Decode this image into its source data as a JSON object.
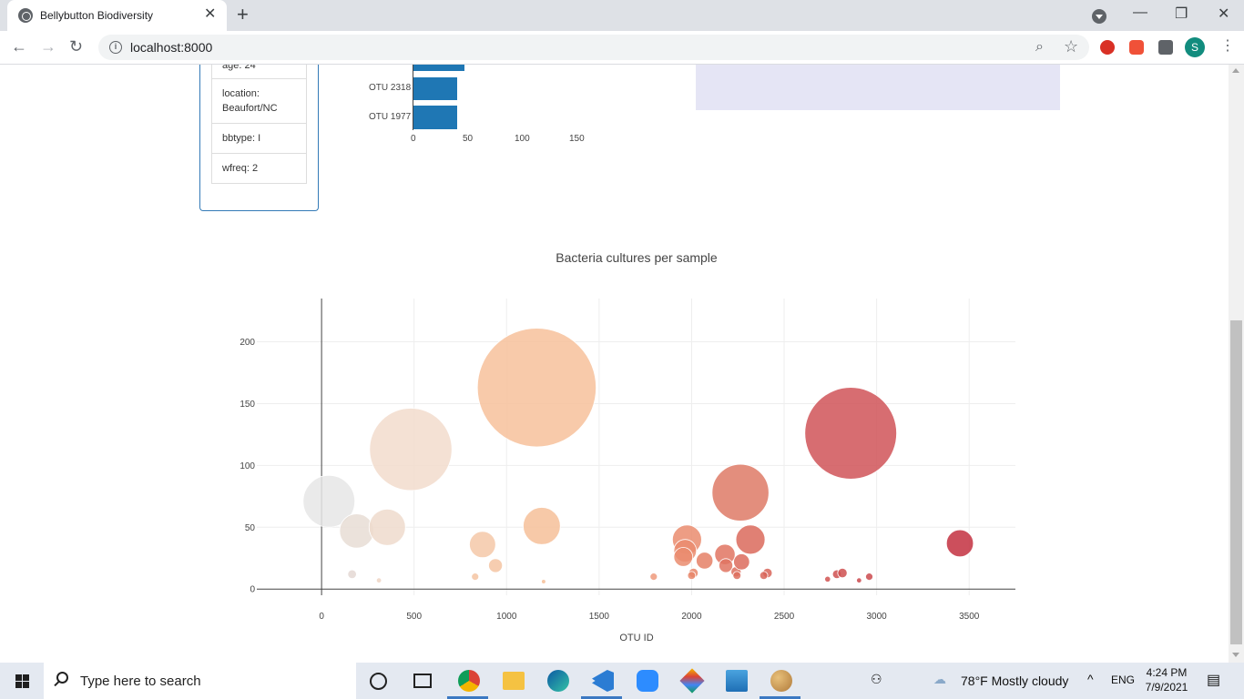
{
  "browser": {
    "tab_title": "Bellybutton Biodiversity",
    "url": "localhost:8000",
    "profile_initial": "S"
  },
  "metadata": {
    "age": "age: 24",
    "location": "location: Beaufort/NC",
    "bbtype": "bbtype: I",
    "wfreq": "wfreq: 2"
  },
  "bar_chart_fragment": {
    "labels": [
      "OTU 2318",
      "OTU 1977"
    ],
    "values": [
      40,
      40
    ],
    "partial_bar_value": 47,
    "x_ticks": [
      "0",
      "50",
      "100",
      "150"
    ]
  },
  "chart_data": {
    "type": "scatter",
    "title": "Bacteria cultures per sample",
    "xlabel": "OTU ID",
    "ylabel": "",
    "xlim": [
      -350,
      3750
    ],
    "ylim": [
      -5,
      235
    ],
    "x_ticks": [
      0,
      500,
      1000,
      1500,
      2000,
      2500,
      3000,
      3500
    ],
    "y_ticks": [
      0,
      50,
      100,
      150,
      200
    ],
    "grid": true,
    "points": [
      {
        "x": 40,
        "y": 71,
        "size": 71,
        "color": "#e6e6e6"
      },
      {
        "x": 190,
        "y": 47,
        "size": 47,
        "color": "#e8ddd5"
      },
      {
        "x": 355,
        "y": 50,
        "size": 50,
        "color": "#eedacc"
      },
      {
        "x": 482,
        "y": 113,
        "size": 113,
        "color": "#f2dccc"
      },
      {
        "x": 165,
        "y": 12,
        "size": 12,
        "color": "#e4d8d4"
      },
      {
        "x": 310,
        "y": 7,
        "size": 7,
        "color": "#efd5c4"
      },
      {
        "x": 870,
        "y": 36,
        "size": 36,
        "color": "#f5c8a8"
      },
      {
        "x": 940,
        "y": 19,
        "size": 19,
        "color": "#f5c4a2"
      },
      {
        "x": 830,
        "y": 10,
        "size": 10,
        "color": "#f5c4a2"
      },
      {
        "x": 1163,
        "y": 163,
        "size": 163,
        "color": "#f7c19b"
      },
      {
        "x": 1190,
        "y": 51,
        "size": 51,
        "color": "#f6bf99"
      },
      {
        "x": 1200,
        "y": 6,
        "size": 6,
        "color": "#f6bf99"
      },
      {
        "x": 1795,
        "y": 10,
        "size": 10,
        "color": "#ee9a7c"
      },
      {
        "x": 1975,
        "y": 40,
        "size": 40,
        "color": "#ea8c6e"
      },
      {
        "x": 1965,
        "y": 31,
        "size": 31,
        "color": "#ea8c6e"
      },
      {
        "x": 1955,
        "y": 26,
        "size": 26,
        "color": "#ea8c6e"
      },
      {
        "x": 2010,
        "y": 13,
        "size": 13,
        "color": "#e8866a"
      },
      {
        "x": 2000,
        "y": 11,
        "size": 11,
        "color": "#e8866a"
      },
      {
        "x": 2070,
        "y": 23,
        "size": 23,
        "color": "#e58066"
      },
      {
        "x": 2180,
        "y": 28,
        "size": 28,
        "color": "#e07461"
      },
      {
        "x": 2185,
        "y": 19,
        "size": 19,
        "color": "#e07461"
      },
      {
        "x": 2240,
        "y": 14,
        "size": 14,
        "color": "#dd6e5e"
      },
      {
        "x": 2245,
        "y": 11,
        "size": 11,
        "color": "#dd6e5e"
      },
      {
        "x": 2270,
        "y": 22,
        "size": 22,
        "color": "#dc6b5d"
      },
      {
        "x": 2264,
        "y": 78,
        "size": 78,
        "color": "#de7a66"
      },
      {
        "x": 2318,
        "y": 40,
        "size": 40,
        "color": "#da6a5c"
      },
      {
        "x": 2410,
        "y": 13,
        "size": 13,
        "color": "#d86559"
      },
      {
        "x": 2390,
        "y": 11,
        "size": 11,
        "color": "#d86559"
      },
      {
        "x": 2735,
        "y": 8,
        "size": 8,
        "color": "#d15451"
      },
      {
        "x": 2785,
        "y": 12,
        "size": 12,
        "color": "#cf5050"
      },
      {
        "x": 2815,
        "y": 13,
        "size": 13,
        "color": "#cf5050"
      },
      {
        "x": 2860,
        "y": 126,
        "size": 126,
        "color": "#d05458"
      },
      {
        "x": 2960,
        "y": 10,
        "size": 10,
        "color": "#cb4a4e"
      },
      {
        "x": 2905,
        "y": 7,
        "size": 7,
        "color": "#cb4a4e"
      },
      {
        "x": 3450,
        "y": 37,
        "size": 37,
        "color": "#c3303f"
      }
    ]
  },
  "taskbar": {
    "search_placeholder": "Type here to search",
    "weather": "78°F  Mostly cloudy",
    "language": "ENG",
    "time": "4:24 PM",
    "date": "7/9/2021"
  }
}
